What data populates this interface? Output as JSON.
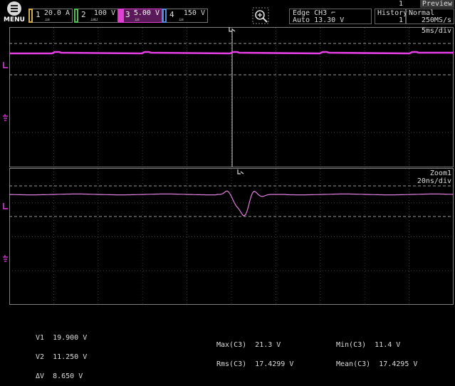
{
  "menu": {
    "label": "MENU"
  },
  "channels": [
    {
      "num": "1",
      "value": "20.0 A",
      "color": "#d4b14a",
      "active": false
    },
    {
      "num": "2",
      "value": "100 V",
      "color": "#4fbf4f",
      "active": false
    },
    {
      "num": "3",
      "value": "5.00 V",
      "color": "#e040d0",
      "active": true
    },
    {
      "num": "4",
      "value": "150 V",
      "color": "#4a8fe0",
      "active": false
    }
  ],
  "trigger": {
    "line1": "Edge CH3 ⌐",
    "line2": "Auto 13.30 V"
  },
  "history": {
    "label": "History",
    "count": "1"
  },
  "acquisition": {
    "mode": "Normal",
    "rate": "250MS/s"
  },
  "preview": {
    "label": "Preview",
    "frame": "1"
  },
  "main_pane": {
    "timebase": "5ms/div"
  },
  "zoom_pane": {
    "title": "Zoom1",
    "timebase": "20ns/div"
  },
  "cursor": {
    "v1": "V1  19.900 V",
    "v2": "V2  11.250 V",
    "dv": "ΔV  8.650 V"
  },
  "measurements": {
    "max": "Max(C3)  21.3 V",
    "rms": "Rms(C3)  17.4299 V",
    "min": "Min(C3)  11.4 V",
    "mean": "Mean(C3)  17.4295 V"
  },
  "colors": {
    "ch3_trace": "#e63fe6",
    "grid": "#3a3a3a",
    "cursor_line": "#9a9a9a"
  }
}
